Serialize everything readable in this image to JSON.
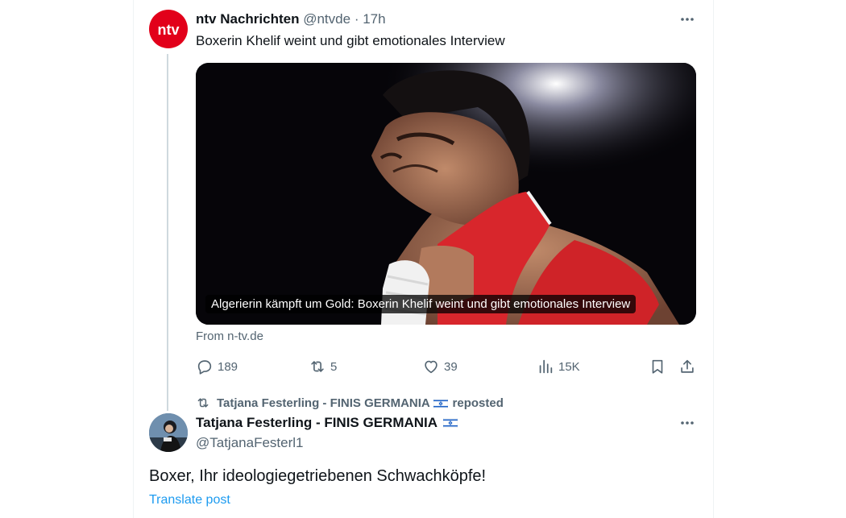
{
  "tweet1": {
    "author_name": "ntv Nachrichten",
    "handle": "@ntvde",
    "separator": "·",
    "time": "17h",
    "avatar_text": "ntv",
    "text": "Boxerin Khelif weint und gibt emotionales Interview",
    "media_caption": "Algerierin kämpft um Gold: Boxerin Khelif weint und gibt emotionales Interview",
    "source": "From n-tv.de",
    "actions": {
      "replies": "189",
      "reposts": "5",
      "likes": "39",
      "views": "15K"
    }
  },
  "repost_banner": {
    "text_before_flag": "Tatjana Festerling - FINIS GERMANIA",
    "text_after_flag": "reposted"
  },
  "tweet2": {
    "author_name": "Tatjana Festerling - FINIS GERMANIA",
    "handle": "@TatjanaFesterl1",
    "text": "Boxer, Ihr ideologiegetriebenen Schwachköpfe!",
    "translate_label": "Translate post"
  },
  "colors": {
    "text_primary": "#0f1419",
    "text_secondary": "#536471",
    "link": "#1d9bf0",
    "ntv_red": "#e2001a",
    "thread_line": "#cfd9de"
  },
  "icons": {
    "more": "more-icon",
    "reply": "reply-icon",
    "repost": "repost-icon",
    "like": "heart-icon",
    "views": "views-icon",
    "bookmark": "bookmark-icon",
    "share": "share-icon",
    "flag": "israel-flag-icon"
  }
}
